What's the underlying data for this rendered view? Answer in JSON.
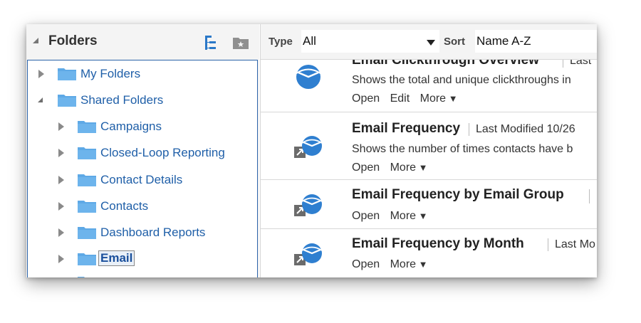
{
  "folders_panel": {
    "title": "Folders",
    "tree": [
      {
        "label": "My Folders",
        "expanded": false,
        "level": 0
      },
      {
        "label": "Shared Folders",
        "expanded": true,
        "level": 0
      },
      {
        "label": "Campaigns",
        "expanded": false,
        "level": 1
      },
      {
        "label": "Closed-Loop Reporting",
        "expanded": false,
        "level": 1
      },
      {
        "label": "Contact Details",
        "expanded": false,
        "level": 1
      },
      {
        "label": "Contacts",
        "expanded": false,
        "level": 1
      },
      {
        "label": "Dashboard Reports",
        "expanded": false,
        "level": 1
      },
      {
        "label": "Email",
        "expanded": false,
        "level": 1,
        "selected": true
      }
    ]
  },
  "filter_bar": {
    "type_label": "Type",
    "type_value": "All",
    "sort_label": "Sort",
    "sort_value": "Name A-Z"
  },
  "items": [
    {
      "name": "Email Clickthrough Overview",
      "meta": "Last",
      "description": "Shows the total and unique clickthroughs in",
      "actions": [
        "Open",
        "Edit",
        "More"
      ]
    },
    {
      "name": "Email Frequency",
      "meta": "Last Modified 10/26",
      "description": "Shows the number of times contacts have b",
      "actions": [
        "Open",
        "More"
      ]
    },
    {
      "name": "Email Frequency by Email Group",
      "meta": "",
      "description": "",
      "actions": [
        "Open",
        "More"
      ]
    },
    {
      "name": "Email Frequency by Month",
      "meta": "Last Mo",
      "description": "",
      "actions": [
        "Open",
        "More"
      ]
    }
  ],
  "colors": {
    "accent": "#1f5fa8",
    "folder": "#5ea9e6",
    "chart_icon": "#2f7fd0"
  }
}
